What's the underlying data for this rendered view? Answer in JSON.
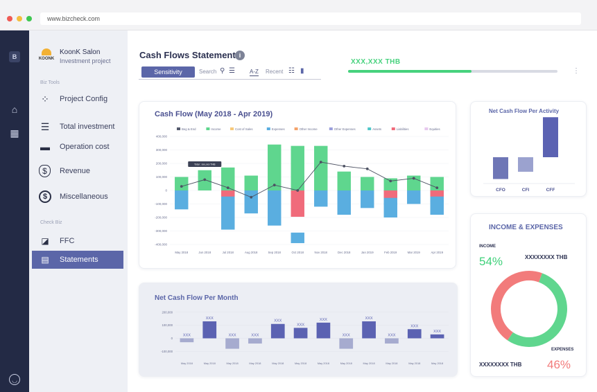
{
  "browser": {
    "url": "www.bizcheck.com"
  },
  "brand": {
    "name": "KoonK Salon",
    "subtitle": "Investment project",
    "logo_text": "KOONK"
  },
  "sidebar": {
    "biz_tools_label": "Biz Tools",
    "check_biz_label": "Check Biz",
    "items": [
      {
        "label": "Project Config",
        "icon": "project-config-icon"
      },
      {
        "label": "Total investment",
        "icon": "coins-stack-icon"
      },
      {
        "label": "Operation cost",
        "icon": "truck-icon"
      },
      {
        "label": "Revenue",
        "icon": "money-bag-icon"
      },
      {
        "label": "Miscellaneous",
        "icon": "dollar-circle-icon"
      },
      {
        "label": "FFC",
        "icon": "ffc-chart-icon"
      },
      {
        "label": "Statements",
        "icon": "statements-icon",
        "active": true
      }
    ]
  },
  "header": {
    "title": "Cash Flows Statement",
    "info_glyph": "i",
    "sensitivity_label": "Sensitivity",
    "search_label": "Search",
    "sort_label": "A-Z",
    "recent_label": "Recent",
    "amount": "XXX,XXX THB",
    "progress": 0.59
  },
  "chart_data": [
    {
      "type": "bar",
      "title": "Cash Flow (May 2018 - Apr 2019)",
      "categories": [
        "May 2018",
        "Jun 2018",
        "Jul 2018",
        "Aug 2018",
        "Sep 2018",
        "Oct 2018",
        "Nov 2018",
        "Dec 2018",
        "Jan 2019",
        "Feb 2019",
        "Mar 2019",
        "Apr 2019"
      ],
      "legend": [
        {
          "name": "Beg & End",
          "color": "#555a6e"
        },
        {
          "name": "Income",
          "color": "#5fd68e"
        },
        {
          "name": "Cost of Sales",
          "color": "#f6c97a"
        },
        {
          "name": "Expenses",
          "color": "#5aaee0"
        },
        {
          "name": "Other Income",
          "color": "#f4a36a"
        },
        {
          "name": "Other Expenses",
          "color": "#9b9fdc"
        },
        {
          "name": "Assets",
          "color": "#4fc7c9"
        },
        {
          "name": "Liabilities",
          "color": "#f06b7b"
        },
        {
          "name": "Equities",
          "color": "#e7c9ee"
        }
      ],
      "yticks": [
        "400,000",
        "300,000",
        "200,000",
        "100,000",
        "0",
        "-100,000",
        "-200,000",
        "-300,000",
        "-400,000"
      ],
      "ylim": [
        -400000,
        400000
      ],
      "income": [
        100000,
        150000,
        170000,
        110000,
        340000,
        330000,
        330000,
        140000,
        100000,
        90000,
        110000,
        100000
      ],
      "expenses": [
        -140000,
        0,
        -290000,
        -170000,
        -260000,
        0,
        -120000,
        -180000,
        -130000,
        -200000,
        -100000,
        -180000
      ],
      "liabilities": [
        0,
        0,
        -90000,
        0,
        0,
        -390000,
        0,
        0,
        0,
        -110000,
        0,
        -90000
      ],
      "net": [
        30000,
        80000,
        20000,
        -50000,
        40000,
        0,
        210000,
        180000,
        160000,
        70000,
        90000,
        20000
      ],
      "tooltip": "Total : xxx,xxx THB"
    },
    {
      "type": "bar",
      "title": "Net Cash Flow Per Activity",
      "categories": [
        "CFO",
        "CFI",
        "CFF"
      ],
      "values": [
        -30,
        -20,
        55
      ],
      "colors": [
        "#6e76b6",
        "#9ba2cf",
        "#5b62b2"
      ]
    },
    {
      "type": "bar",
      "title": "Net Cash Flow Per Month",
      "categories": [
        "May 2018",
        "May 2018",
        "May 2018",
        "May 2018",
        "May 2018",
        "May 2018",
        "May 2018",
        "May 2018",
        "May 2018",
        "May 2018",
        "May 2018",
        "May 2018"
      ],
      "values": [
        -30000,
        130000,
        -80000,
        -40000,
        110000,
        80000,
        120000,
        -80000,
        130000,
        -40000,
        70000,
        30000
      ],
      "yticks": [
        "200,000",
        "100,000",
        "0",
        "-100,000"
      ],
      "ylim": [
        -130000,
        220000
      ],
      "data_label": "XXX"
    },
    {
      "type": "pie",
      "title": "INCOME & EXPENSES",
      "labels": [
        "INCOME",
        "EXPENSES"
      ],
      "values": [
        54,
        46
      ],
      "colors": [
        "#5fd68e",
        "#f27b7b"
      ]
    }
  ],
  "income_expenses": {
    "income_label": "INCOME",
    "income_pct": "54%",
    "income_amount": "XXXXXXXX THB",
    "expenses_label": "EXPENSES",
    "expenses_pct": "46%",
    "expenses_amount": "XXXXXXXX THB"
  },
  "colors": {
    "accent": "#5b66a8",
    "positive": "#46d27d",
    "negative": "#f27b7b",
    "rail": "#232a45"
  }
}
